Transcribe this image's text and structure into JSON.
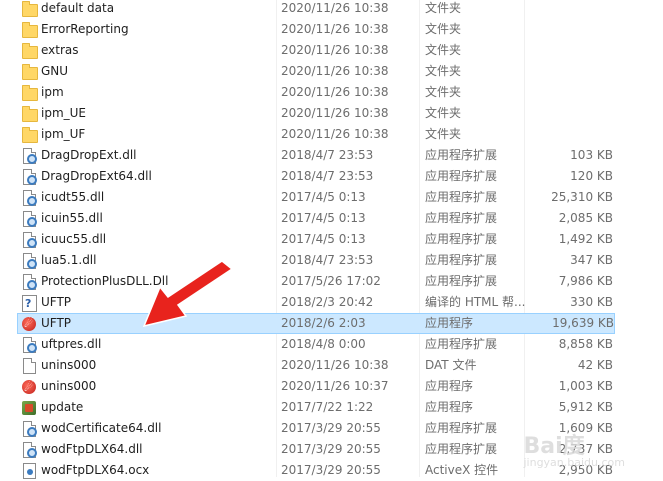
{
  "files": [
    {
      "icon": "folder-icon",
      "name": "default data",
      "date": "2020/11/26 10:38",
      "type": "文件夹",
      "size": ""
    },
    {
      "icon": "folder-icon",
      "name": "ErrorReporting",
      "date": "2020/11/26 10:38",
      "type": "文件夹",
      "size": ""
    },
    {
      "icon": "folder-icon",
      "name": "extras",
      "date": "2020/11/26 10:38",
      "type": "文件夹",
      "size": ""
    },
    {
      "icon": "folder-icon",
      "name": "GNU",
      "date": "2020/11/26 10:38",
      "type": "文件夹",
      "size": ""
    },
    {
      "icon": "folder-icon",
      "name": "ipm",
      "date": "2020/11/26 10:38",
      "type": "文件夹",
      "size": ""
    },
    {
      "icon": "folder-icon",
      "name": "ipm_UE",
      "date": "2020/11/26 10:38",
      "type": "文件夹",
      "size": ""
    },
    {
      "icon": "folder-icon",
      "name": "ipm_UF",
      "date": "2020/11/26 10:38",
      "type": "文件夹",
      "size": ""
    },
    {
      "icon": "dll-icon",
      "name": "DragDropExt.dll",
      "date": "2018/4/7 23:53",
      "type": "应用程序扩展",
      "size": "103 KB"
    },
    {
      "icon": "dll-icon",
      "name": "DragDropExt64.dll",
      "date": "2018/4/7 23:53",
      "type": "应用程序扩展",
      "size": "120 KB"
    },
    {
      "icon": "dll-icon",
      "name": "icudt55.dll",
      "date": "2017/4/5 0:13",
      "type": "应用程序扩展",
      "size": "25,310 KB"
    },
    {
      "icon": "dll-icon",
      "name": "icuin55.dll",
      "date": "2017/4/5 0:13",
      "type": "应用程序扩展",
      "size": "2,085 KB"
    },
    {
      "icon": "dll-icon",
      "name": "icuuc55.dll",
      "date": "2017/4/5 0:13",
      "type": "应用程序扩展",
      "size": "1,492 KB"
    },
    {
      "icon": "dll-icon",
      "name": "lua5.1.dll",
      "date": "2018/4/7 23:53",
      "type": "应用程序扩展",
      "size": "347 KB"
    },
    {
      "icon": "dll-icon",
      "name": "ProtectionPlusDLL.Dll",
      "date": "2017/5/26 17:02",
      "type": "应用程序扩展",
      "size": "7,986 KB"
    },
    {
      "icon": "help-icon",
      "name": "UFTP",
      "date": "2018/2/3 20:42",
      "type": "编译的 HTML 帮...",
      "size": "330 KB"
    },
    {
      "icon": "app-icon",
      "name": "UFTP",
      "date": "2018/2/6 2:03",
      "type": "应用程序",
      "size": "19,639 KB",
      "selected": true
    },
    {
      "icon": "dll-icon",
      "name": "uftpres.dll",
      "date": "2018/4/8 0:00",
      "type": "应用程序扩展",
      "size": "8,858 KB"
    },
    {
      "icon": "file-icon",
      "name": "unins000",
      "date": "2020/11/26 10:38",
      "type": "DAT 文件",
      "size": "42 KB"
    },
    {
      "icon": "app-icon",
      "name": "unins000",
      "date": "2020/11/26 10:37",
      "type": "应用程序",
      "size": "1,003 KB"
    },
    {
      "icon": "update-icon",
      "name": "update",
      "date": "2017/7/22 1:22",
      "type": "应用程序",
      "size": "5,912 KB"
    },
    {
      "icon": "dll-icon",
      "name": "wodCertificate64.dll",
      "date": "2017/3/29 20:55",
      "type": "应用程序扩展",
      "size": "1,609 KB"
    },
    {
      "icon": "dll-icon",
      "name": "wodFtpDLX64.dll",
      "date": "2017/3/29 20:55",
      "type": "应用程序扩展",
      "size": "2,737 KB"
    },
    {
      "icon": "ocx-icon",
      "name": "wodFtpDLX64.ocx",
      "date": "2017/3/29 20:55",
      "type": "ActiveX 控件",
      "size": "2,950 KB"
    }
  ],
  "watermark": {
    "text": "Bai度",
    "sub": "jingyan.baidu.com"
  },
  "colors": {
    "arrow": "#e8231d",
    "selection": "#cce8ff"
  }
}
